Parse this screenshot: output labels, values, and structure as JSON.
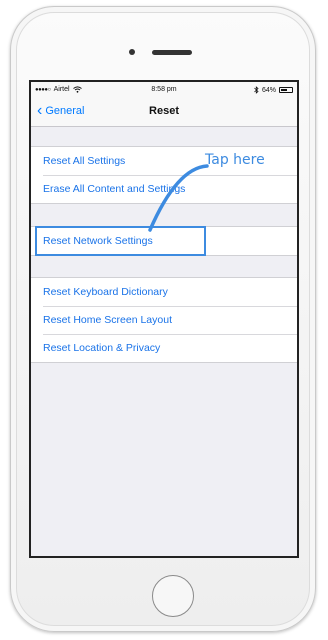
{
  "status_bar": {
    "signal_dots": "●●●●○",
    "carrier": "Airtel",
    "wifi_icon": "wifi-icon",
    "time": "8:58 pm",
    "bluetooth_icon": "bluetooth-icon",
    "battery_percent": "64%",
    "battery_level": 0.64
  },
  "nav": {
    "back_label": "General",
    "title": "Reset"
  },
  "groups": [
    {
      "items": [
        "Reset All Settings",
        "Erase All Content and Settings"
      ]
    },
    {
      "items": [
        "Reset Network Settings"
      ]
    },
    {
      "items": [
        "Reset Keyboard Dictionary",
        "Reset Home Screen Layout",
        "Reset Location & Privacy"
      ]
    }
  ],
  "annotation": {
    "text": "Tap here",
    "color": "#3d8be0"
  },
  "colors": {
    "link": "#1a73e8",
    "ios_blue": "#007aff",
    "background": "#efeff4"
  }
}
